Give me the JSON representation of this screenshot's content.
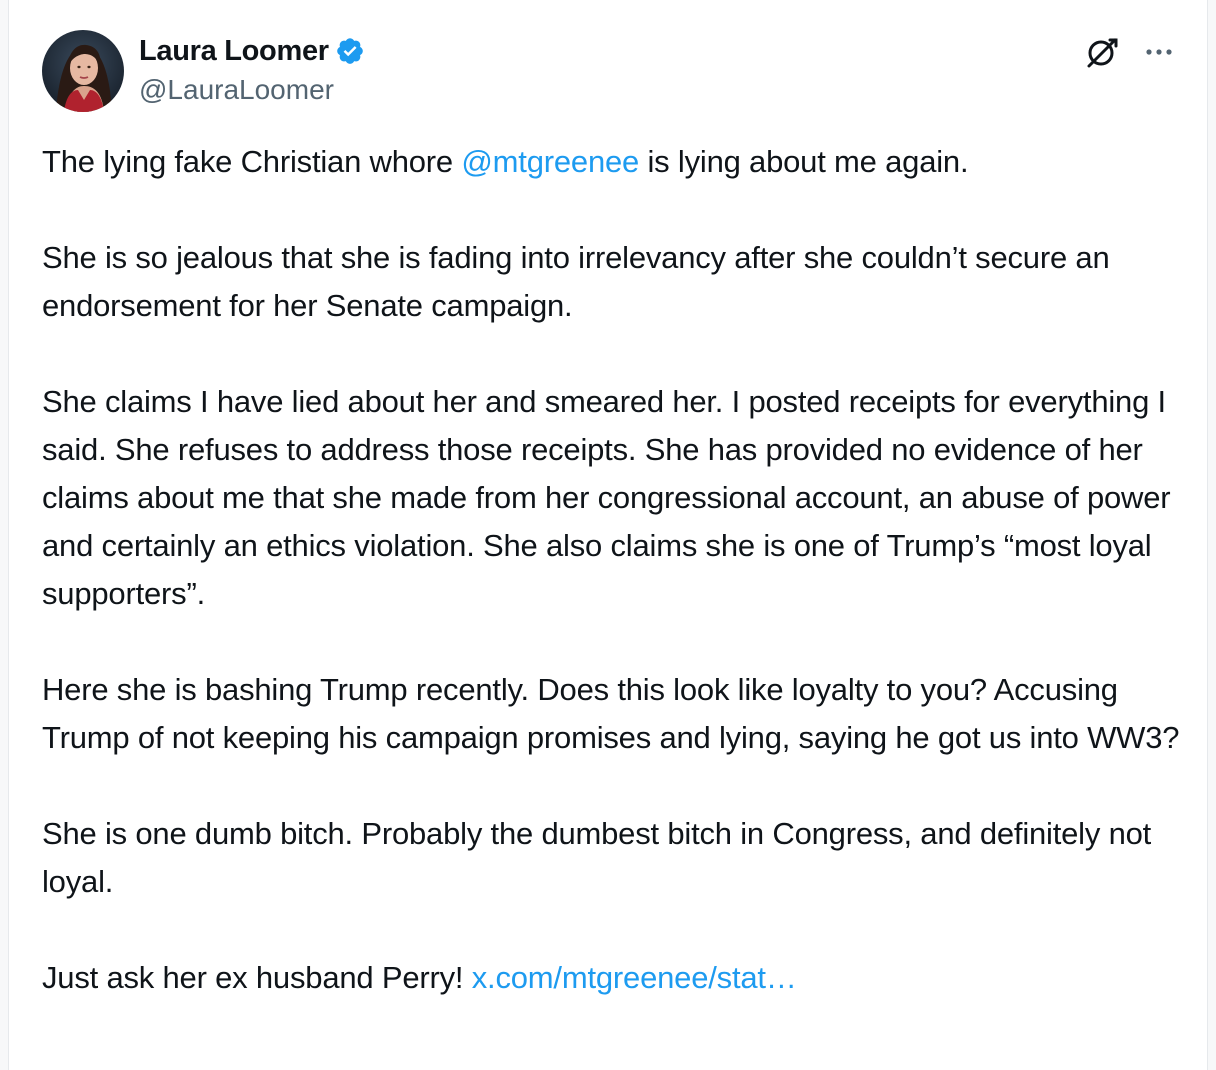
{
  "author": {
    "display_name": "Laura Loomer",
    "handle": "@LauraLoomer",
    "verified": true,
    "verified_color": "#1d9bf0"
  },
  "header_actions": {
    "grok_icon": "grok-icon",
    "more_icon": "more-options-icon"
  },
  "tweet": {
    "p1_before": "The lying fake Christian whore ",
    "p1_mention": "@mtgreenee",
    "p1_after": " is lying about me again.",
    "p2": "She is so jealous that she is fading into irrelevancy after she couldn’t secure an endorsement for her Senate campaign.",
    "p3": "She claims I have lied about her and smeared her. I posted receipts for everything I said. She refuses to address those receipts. She has provided no evidence of her claims about me that she made from her congressional account, an abuse of power and certainly an ethics violation. She also claims she is one of Trump’s “most loyal supporters”.",
    "p4": "Here she is bashing Trump recently. Does this look like loyalty to you? Accusing Trump of not keeping his campaign promises and lying, saying he got us into WW3?",
    "p5": "She is one dumb bitch. Probably the dumbest bitch in Congress, and definitely not loyal.",
    "p6_before": "Just ask her ex husband Perry! ",
    "p6_link": "x.com/mtgreenee/stat…"
  },
  "colors": {
    "text": "#0f1419",
    "secondary": "#536471",
    "link": "#1d9bf0"
  }
}
